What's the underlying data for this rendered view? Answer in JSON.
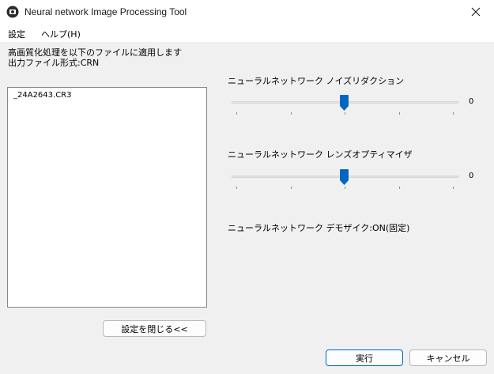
{
  "window": {
    "title": "Neural network Image Processing Tool"
  },
  "menu": {
    "settings": "設定",
    "help": "ヘルプ(H)"
  },
  "info": {
    "line1": "高画質化処理を以下のファイルに適用します",
    "line2": "出力ファイル形式:CRN"
  },
  "files": [
    "_24A2643.CR3"
  ],
  "noise_reduction": {
    "label": "ニューラルネットワーク ノイズリダクション",
    "value": "0",
    "level_fraction": 0.5
  },
  "lens_optimizer": {
    "label": "ニューラルネットワーク レンズオプティマイザ",
    "value": "0",
    "level_fraction": 0.5
  },
  "demosaic": {
    "label": "ニューラルネットワーク デモザイク:ON(固定)"
  },
  "buttons": {
    "close_settings": "設定を閉じる<<",
    "execute": "実行",
    "cancel": "キャンセル"
  },
  "icons": {
    "app": "app-camera-icon",
    "close": "close-icon"
  },
  "colors": {
    "accent": "#0067c0",
    "thumb": "#0067c0"
  }
}
